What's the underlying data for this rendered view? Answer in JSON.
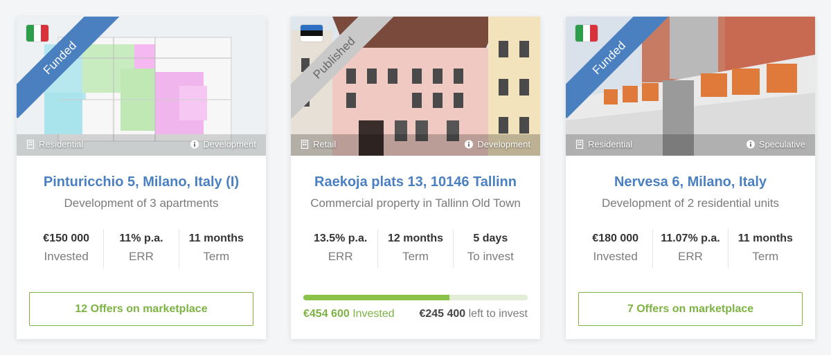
{
  "colors": {
    "funded_ribbon": "#4a7fc0",
    "published_ribbon": "#c9c9c9",
    "title": "#4a7fc0",
    "accent_green": "#7cb342"
  },
  "cards": [
    {
      "flag": "italy",
      "ribbon": "Funded",
      "type_icon": "building-icon",
      "type": "Residential",
      "stage_icon": "info-icon",
      "stage": "Development",
      "title": "Pinturicchio 5, Milano, Italy (I)",
      "subtitle": "Development of 3 apartments",
      "stats": [
        {
          "value": "€150 000",
          "label": "Invested"
        },
        {
          "value": "11% p.a.",
          "label": "ERR"
        },
        {
          "value": "11 months",
          "label": "Term"
        }
      ],
      "offers_button": "12 Offers on marketplace"
    },
    {
      "flag": "estonia",
      "ribbon": "Published",
      "type_icon": "building-icon",
      "type": "Retail",
      "stage_icon": "info-icon",
      "stage": "Development",
      "title": "Raekoja plats 13, 10146 Tallinn",
      "subtitle": "Commercial property in Tallinn Old Town",
      "stats": [
        {
          "value": "13.5% p.a.",
          "label": "ERR"
        },
        {
          "value": "12 months",
          "label": "Term"
        },
        {
          "value": "5 days",
          "label": "To invest"
        }
      ],
      "progress": {
        "fraction": 0.65,
        "invested_amount": "€454 600",
        "invested_label": "Invested",
        "left_amount": "€245 400",
        "left_label": "left to invest"
      }
    },
    {
      "flag": "italy",
      "ribbon": "Funded",
      "type_icon": "building-icon",
      "type": "Residential",
      "stage_icon": "info-icon",
      "stage": "Speculative",
      "title": "Nervesa 6, Milano, Italy",
      "subtitle": "Development of 2 residential units",
      "stats": [
        {
          "value": "€180 000",
          "label": "Invested"
        },
        {
          "value": "11.07% p.a.",
          "label": "ERR"
        },
        {
          "value": "11 months",
          "label": "Term"
        }
      ],
      "offers_button": "7 Offers on marketplace"
    }
  ]
}
